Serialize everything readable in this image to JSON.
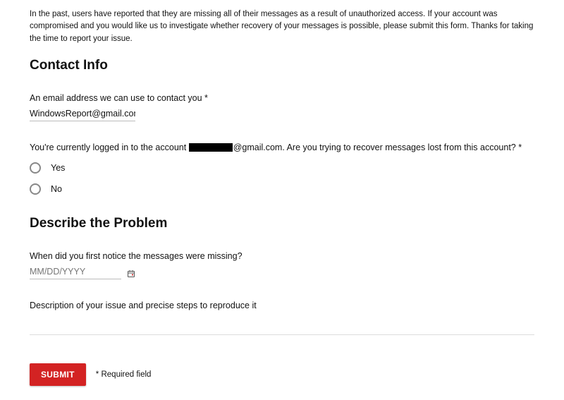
{
  "intro": "In the past, users have reported that they are missing all of their messages as a result of unauthorized access. If your account was compromised and you would like us to investigate whether recovery of your messages is possible, please submit this form. Thanks for taking the time to report your issue.",
  "sections": {
    "contact": {
      "heading": "Contact Info",
      "email_label": "An email address we can use to contact you *",
      "email_value": "WindowsReport@gmail.com",
      "logged_in_prefix": "You're currently logged in to the account ",
      "logged_in_domain": "@gmail.com",
      "logged_in_suffix": ". Are you trying to recover messages lost from this account? *",
      "options": {
        "yes": "Yes",
        "no": "No"
      }
    },
    "problem": {
      "heading": "Describe the Problem",
      "when_label": "When did you first notice the messages were missing?",
      "date_placeholder": "MM/DD/YYYY",
      "desc_label": "Description of your issue and precise steps to reproduce it"
    }
  },
  "footer": {
    "submit": "SUBMIT",
    "required": "* Required field"
  },
  "colors": {
    "accent": "#d32323"
  }
}
